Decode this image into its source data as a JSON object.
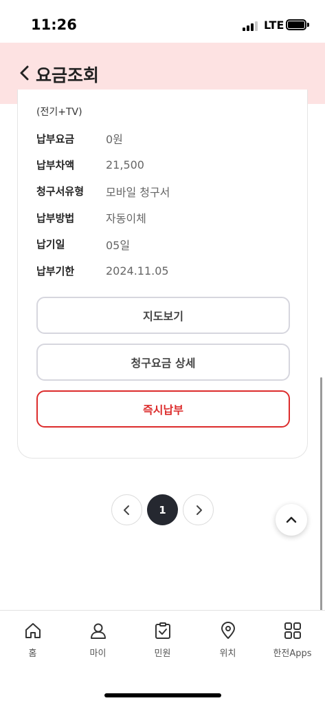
{
  "status_bar": {
    "time": "11:26",
    "network": "LTE"
  },
  "header": {
    "title": "요금조회"
  },
  "card": {
    "overflow_text": "(전기+TV)",
    "rows": [
      {
        "label": "납부요금",
        "value": "0원"
      },
      {
        "label": "납부차액",
        "value": "21,500"
      },
      {
        "label": "청구서유형",
        "value": "모바일 청구서"
      },
      {
        "label": "납부방법",
        "value": "자동이체"
      },
      {
        "label": "납기일",
        "value": "05일"
      },
      {
        "label": "납부기한",
        "value": "2024.11.05"
      }
    ],
    "buttons": {
      "map": "지도보기",
      "detail": "청구요금 상세",
      "pay": "즉시납부"
    }
  },
  "pagination": {
    "current": "1"
  },
  "bottom_nav": {
    "items": [
      {
        "label": "홈",
        "icon": "home-icon"
      },
      {
        "label": "마이",
        "icon": "person-icon"
      },
      {
        "label": "민원",
        "icon": "clipboard-check-icon"
      },
      {
        "label": "위치",
        "icon": "location-pin-icon"
      },
      {
        "label": "한전Apps",
        "icon": "apps-grid-icon"
      }
    ]
  },
  "colors": {
    "header_bg": "#fde2e2",
    "accent": "#dc2b2b",
    "pager_active": "#252830"
  }
}
